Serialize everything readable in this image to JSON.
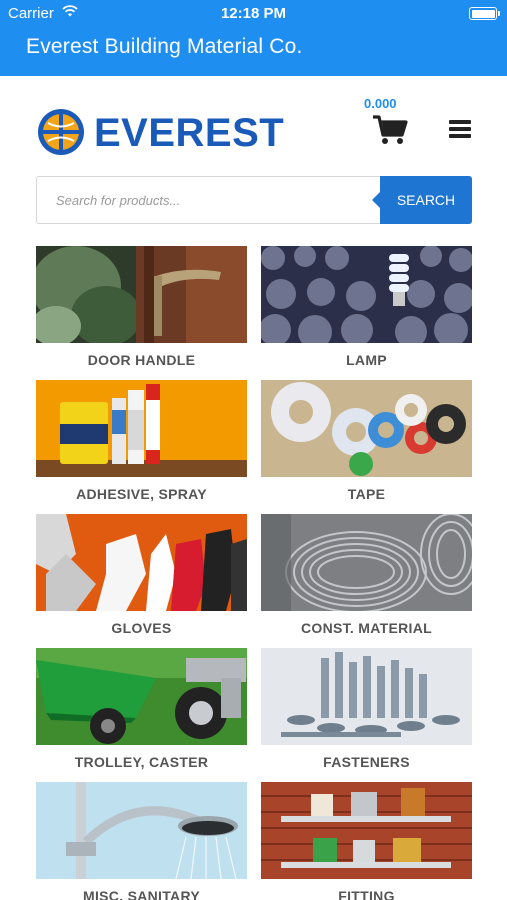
{
  "status_bar": {
    "carrier": "Carrier",
    "time": "12:18 PM"
  },
  "app": {
    "title": "Everest Building Material Co."
  },
  "header": {
    "logo_text": "EVEREST",
    "cart_total": "0.000"
  },
  "search": {
    "placeholder": "Search for products...",
    "button_label": "SEARCH"
  },
  "categories": [
    {
      "label": "DOOR HANDLE",
      "image": "door-handle-photo"
    },
    {
      "label": "LAMP",
      "image": "lamp-bulbs-photo"
    },
    {
      "label": "ADHESIVE, SPRAY",
      "image": "adhesive-cans-photo"
    },
    {
      "label": "TAPE",
      "image": "tape-rolls-photo"
    },
    {
      "label": "GLOVES",
      "image": "gloves-photo"
    },
    {
      "label": "CONST. MATERIAL",
      "image": "wire-coils-photo"
    },
    {
      "label": "TROLLEY, CASTER",
      "image": "wheelbarrow-caster-photo"
    },
    {
      "label": "FASTENERS",
      "image": "bolts-fasteners-photo"
    },
    {
      "label": "MISC. SANITARY",
      "image": "shower-head-photo"
    },
    {
      "label": "FITTING",
      "image": "pipe-fittings-photo"
    }
  ],
  "colors": {
    "brand_blue": "#1f8ef1",
    "logo_blue": "#1a5ab8",
    "search_button": "#1f76d2"
  }
}
